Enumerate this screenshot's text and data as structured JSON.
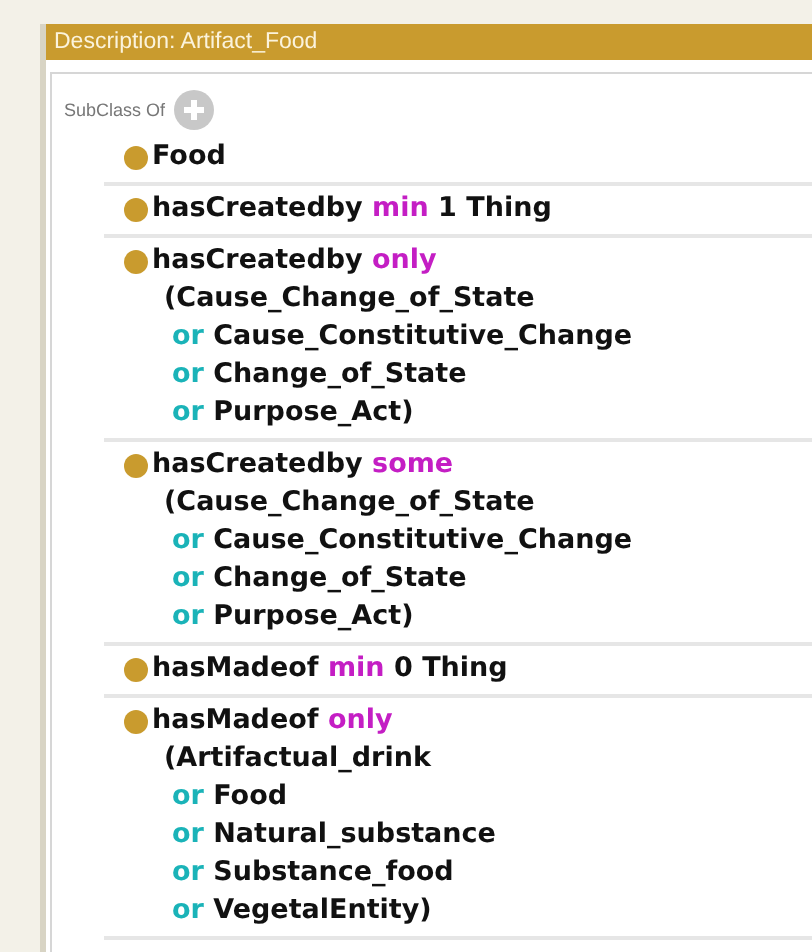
{
  "panel": {
    "title": "Description: Artifact_Food"
  },
  "section": {
    "label": "SubClass Of"
  },
  "axioms": [
    {
      "lines": [
        [
          {
            "text": "Food",
            "kind": "plain"
          }
        ]
      ]
    },
    {
      "lines": [
        [
          {
            "text": "hasCreatedby ",
            "kind": "plain"
          },
          {
            "text": "min",
            "kind": "keyword"
          },
          {
            "text": " 1 Thing",
            "kind": "plain"
          }
        ]
      ]
    },
    {
      "lines": [
        [
          {
            "text": "hasCreatedby ",
            "kind": "plain"
          },
          {
            "text": "only",
            "kind": "keyword"
          }
        ],
        [
          {
            "text": "(Cause_Change_of_State",
            "kind": "plain"
          }
        ],
        [
          {
            "text": "or",
            "kind": "connective"
          },
          {
            "text": " Cause_Constitutive_Change",
            "kind": "plain"
          }
        ],
        [
          {
            "text": "or",
            "kind": "connective"
          },
          {
            "text": " Change_of_State",
            "kind": "plain"
          }
        ],
        [
          {
            "text": "or",
            "kind": "connective"
          },
          {
            "text": " Purpose_Act)",
            "kind": "plain"
          }
        ]
      ]
    },
    {
      "lines": [
        [
          {
            "text": "hasCreatedby ",
            "kind": "plain"
          },
          {
            "text": "some",
            "kind": "keyword"
          }
        ],
        [
          {
            "text": "(Cause_Change_of_State",
            "kind": "plain"
          }
        ],
        [
          {
            "text": "or",
            "kind": "connective"
          },
          {
            "text": " Cause_Constitutive_Change",
            "kind": "plain"
          }
        ],
        [
          {
            "text": "or",
            "kind": "connective"
          },
          {
            "text": " Change_of_State",
            "kind": "plain"
          }
        ],
        [
          {
            "text": "or",
            "kind": "connective"
          },
          {
            "text": " Purpose_Act)",
            "kind": "plain"
          }
        ]
      ]
    },
    {
      "lines": [
        [
          {
            "text": "hasMadeof ",
            "kind": "plain"
          },
          {
            "text": "min",
            "kind": "keyword"
          },
          {
            "text": " 0 Thing",
            "kind": "plain"
          }
        ]
      ]
    },
    {
      "lines": [
        [
          {
            "text": "hasMadeof ",
            "kind": "plain"
          },
          {
            "text": "only",
            "kind": "keyword"
          }
        ],
        [
          {
            "text": "(Artifactual_drink",
            "kind": "plain"
          }
        ],
        [
          {
            "text": "or",
            "kind": "connective"
          },
          {
            "text": " Food",
            "kind": "plain"
          }
        ],
        [
          {
            "text": "or",
            "kind": "connective"
          },
          {
            "text": " Natural_substance",
            "kind": "plain"
          }
        ],
        [
          {
            "text": "or",
            "kind": "connective"
          },
          {
            "text": " Substance_food",
            "kind": "plain"
          }
        ],
        [
          {
            "text": "or",
            "kind": "connective"
          },
          {
            "text": " VegetalEntity)",
            "kind": "plain"
          }
        ]
      ]
    }
  ]
}
